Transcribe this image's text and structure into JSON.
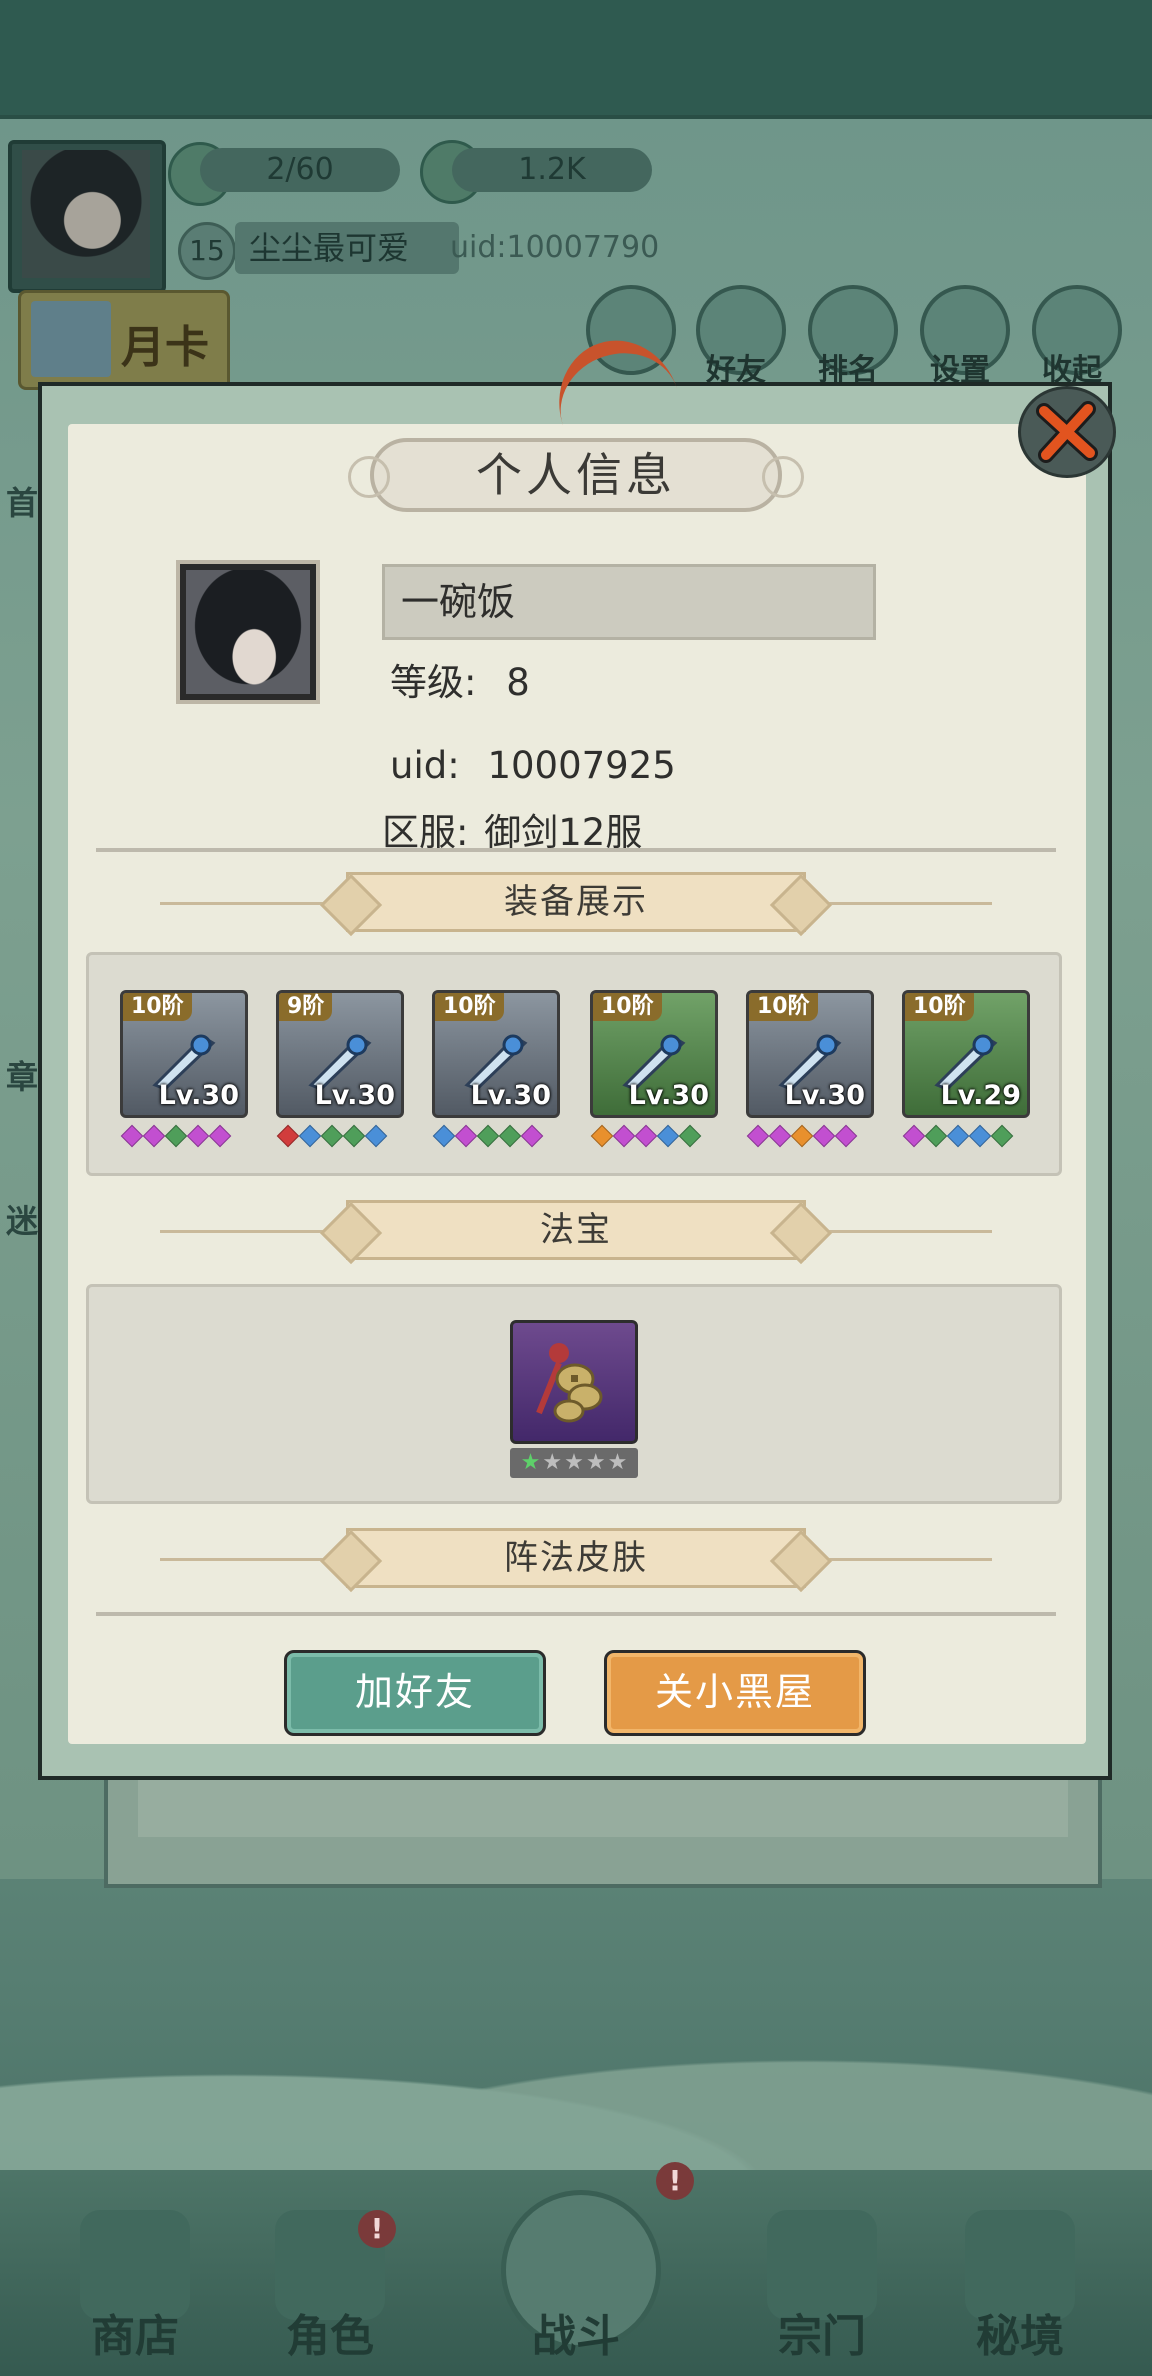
{
  "top_bar": {
    "stamina": "2/60",
    "currency": "1.2K",
    "player_level": "15",
    "player_name": "尘尘最可爱",
    "uid": "uid:10007790",
    "month_card": "月卡",
    "buttons": [
      "好友",
      "排名",
      "设置",
      "收起"
    ]
  },
  "side_labels": [
    "首",
    "章",
    "迷"
  ],
  "modal": {
    "title": "个人信息",
    "name": "一碗饭",
    "level_label": "等级:",
    "level_value": "8",
    "uid_label": "uid:",
    "uid_value": "10007925",
    "server_label": "区服:",
    "server_value": "御剑12服",
    "equip_section": "装备展示",
    "fabao_section": "法宝",
    "formation_section": "阵法皮肤",
    "add_friend_button": "加好友",
    "block_button": "关小黑屋"
  },
  "equipment": [
    {
      "tier": "10阶",
      "level": "Lv.30",
      "frame": "blue",
      "gems": [
        "#c24fd0",
        "#c24fd0",
        "#4f9e5a",
        "#c24fd0",
        "#c24fd0"
      ]
    },
    {
      "tier": "9阶",
      "level": "Lv.30",
      "frame": "blue",
      "gems": [
        "#d13c3c",
        "#4a8fd8",
        "#4f9e5a",
        "#4f9e5a",
        "#4a8fd8"
      ]
    },
    {
      "tier": "10阶",
      "level": "Lv.30",
      "frame": "blue",
      "gems": [
        "#4a8fd8",
        "#c24fd0",
        "#4f9e5a",
        "#4f9e5a",
        "#c24fd0"
      ]
    },
    {
      "tier": "10阶",
      "level": "Lv.30",
      "frame": "green",
      "gems": [
        "#e8902d",
        "#c24fd0",
        "#c24fd0",
        "#4a8fd8",
        "#4f9e5a"
      ]
    },
    {
      "tier": "10阶",
      "level": "Lv.30",
      "frame": "blue",
      "gems": [
        "#c24fd0",
        "#c24fd0",
        "#e8902d",
        "#c24fd0",
        "#c24fd0"
      ]
    },
    {
      "tier": "10阶",
      "level": "Lv.29",
      "frame": "green",
      "gems": [
        "#c24fd0",
        "#4f9e5a",
        "#4a8fd8",
        "#4a8fd8",
        "#4f9e5a"
      ]
    }
  ],
  "fabao": {
    "stars_filled": 1,
    "stars_total": 5
  },
  "bottom_nav": [
    "商店",
    "角色",
    "战斗",
    "宗门",
    "秘境"
  ],
  "colors": {
    "accent_green": "#5b9e8c",
    "accent_orange": "#e49a47",
    "close_red": "#e2541f"
  }
}
